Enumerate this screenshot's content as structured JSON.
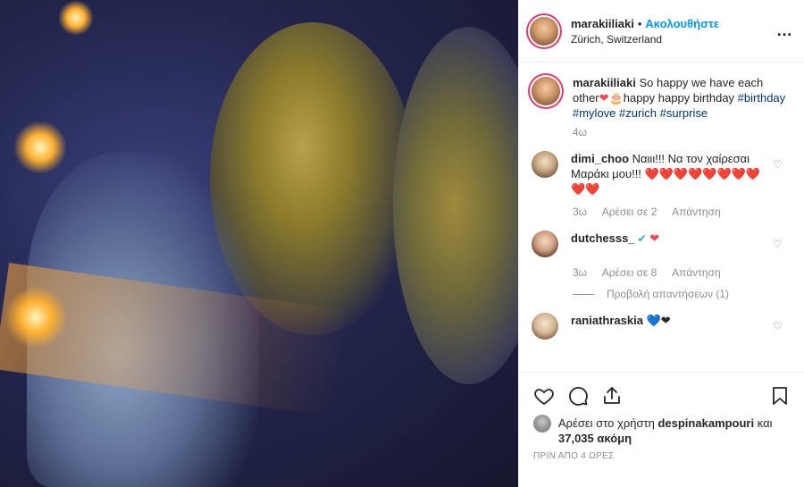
{
  "header": {
    "username": "marakiiliaki",
    "separator": "•",
    "follow_label": "Ακολουθήστε",
    "location": "Zürich, Switzerland",
    "more_icon": "…"
  },
  "caption": {
    "username": "marakiiliaki",
    "text_1": "So happy we have each other",
    "text_2": "happy happy birthday",
    "hashtags": [
      "#birthday",
      "#mylove",
      "#zurich",
      "#surprise"
    ],
    "time": "4ω"
  },
  "comments": [
    {
      "username": "dimi_choo",
      "text": "Ναιιι!!! Να τον χαίρεσαι Μαράκι μου!!!",
      "hearts": "❤️❤️❤️❤️❤️❤️❤️❤️❤️❤️",
      "time": "3ω",
      "likes": "Αρέσει σε 2",
      "reply": "Απάντηση"
    },
    {
      "username": "dutchesss_",
      "text": "",
      "hearts": "❤",
      "time": "3ω",
      "likes": "Αρέσει σε 8",
      "reply": "Απάντηση",
      "view_replies": "Προβολή απαντήσεων (1)"
    },
    {
      "username": "raniathraskia",
      "text": "",
      "hearts": "💙❤"
    }
  ],
  "likes": {
    "prefix": "Αρέσει στο χρήστη",
    "user": "despinakampouri",
    "middle": "και",
    "count": "37,035",
    "suffix": "ακόμη"
  },
  "timestamp": "ΠΡΙΝ ΑΠΟ 4 ΩΡΕΣ",
  "colors": {
    "follow": "#0095f6",
    "hashtag": "#00376b",
    "muted": "#8e8e8e",
    "heart": "#ed4956"
  }
}
